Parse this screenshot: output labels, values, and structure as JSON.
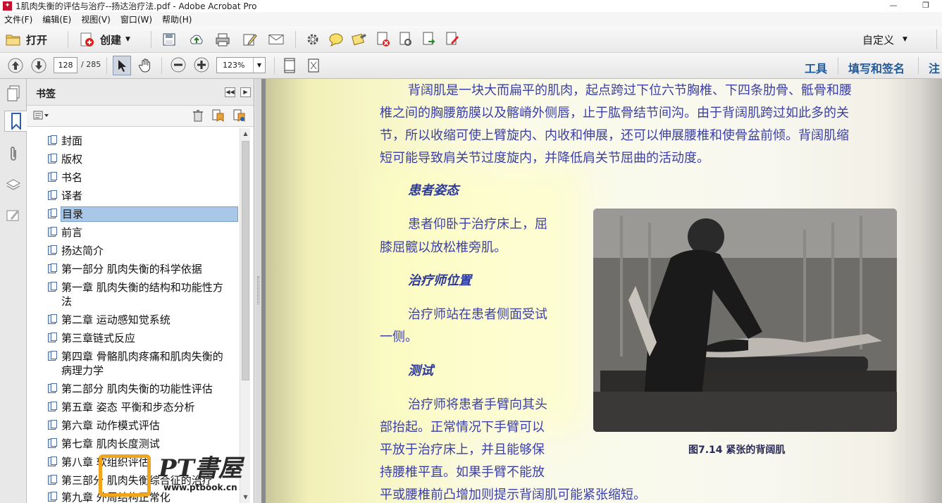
{
  "window": {
    "title": "1肌肉失衡的评估与治疗--扬达治疗法.pdf - Adobe Acrobat Pro",
    "app_icon": "pdf-app-icon",
    "controls": [
      "—",
      "❐",
      "✕"
    ]
  },
  "menu": {
    "items": [
      "文件(F)",
      "编辑(E)",
      "视图(V)",
      "窗口(W)",
      "帮助(H)"
    ]
  },
  "toolbar": {
    "open_label": "打开",
    "create_label": "创建",
    "customize_label": "自定义",
    "icons": [
      "save-icon",
      "upload-icon",
      "print-icon",
      "edit-icon",
      "email-icon",
      "settings-icon",
      "comment-icon",
      "stamp-icon",
      "delete-page-icon",
      "security-icon",
      "export-icon",
      "sign-icon"
    ]
  },
  "nav": {
    "current_page": "128",
    "total_pages": "/ 285",
    "zoom": "123%",
    "right_links": [
      "工具",
      "填写和签名",
      "注释"
    ]
  },
  "bookmarks_panel": {
    "title": "书签",
    "items": [
      {
        "label": "封面"
      },
      {
        "label": "版权"
      },
      {
        "label": "书名"
      },
      {
        "label": "译者"
      },
      {
        "label": "目录",
        "selected": true
      },
      {
        "label": "前言"
      },
      {
        "label": "扬达简介"
      },
      {
        "label": "第一部分  肌肉失衡的科学依据"
      },
      {
        "label": "第一章 肌肉失衡的结构和功能性方法"
      },
      {
        "label": "第二章 运动感知觉系统"
      },
      {
        "label": "第三章链式反应"
      },
      {
        "label": "第四章 骨骼肌肉疼痛和肌肉失衡的病理力学"
      },
      {
        "label": "第二部分  肌肉失衡的功能性评估"
      },
      {
        "label": "第五章 姿态 平衡和步态分析"
      },
      {
        "label": "第六章 动作模式评估"
      },
      {
        "label": "第七章 肌肉长度测试"
      },
      {
        "label": "第八章 软组织评估"
      },
      {
        "label": "第三部分 肌肉失衡综合征的治疗"
      },
      {
        "label": "第九章 外周结构正常化"
      }
    ]
  },
  "document": {
    "paragraph1": [
      "背阔肌是一块大而扁平的肌肉，起点跨过下位六节胸椎、下四条肋骨、骶骨和腰",
      "椎之间的胸腰筋膜以及髂嵴外侧唇，止于肱骨结节间沟。由于背阔肌跨过如此多的关",
      "节，所以收缩可使上臂旋内、内收和伸展，还可以伸展腰椎和使骨盆前倾。背阔肌缩",
      "短可能导致肩关节过度旋内，并降低肩关节屈曲的活动度。"
    ],
    "heading_posture": "患者姿态",
    "posture_text": [
      "患者仰卧于治疗床上，屈",
      "膝屈髋以放松椎旁肌。"
    ],
    "heading_therapist": "治疗师位置",
    "therapist_text": [
      "治疗师站在患者侧面受试",
      "一侧。"
    ],
    "heading_test": "测试",
    "test_text": [
      "治疗师将患者手臂向其头",
      "部抬起。正常情况下手臂可以",
      "平放于治疗床上，并且能够保",
      "持腰椎平直。如果手臂不能放",
      "平或腰椎前凸增加则提示背阔肌可能紧张缩短。"
    ],
    "figure_caption": "图7.14  紧张的背阔肌"
  },
  "watermark": {
    "text": "PT書屋",
    "url": "www.ptbook.cn"
  }
}
